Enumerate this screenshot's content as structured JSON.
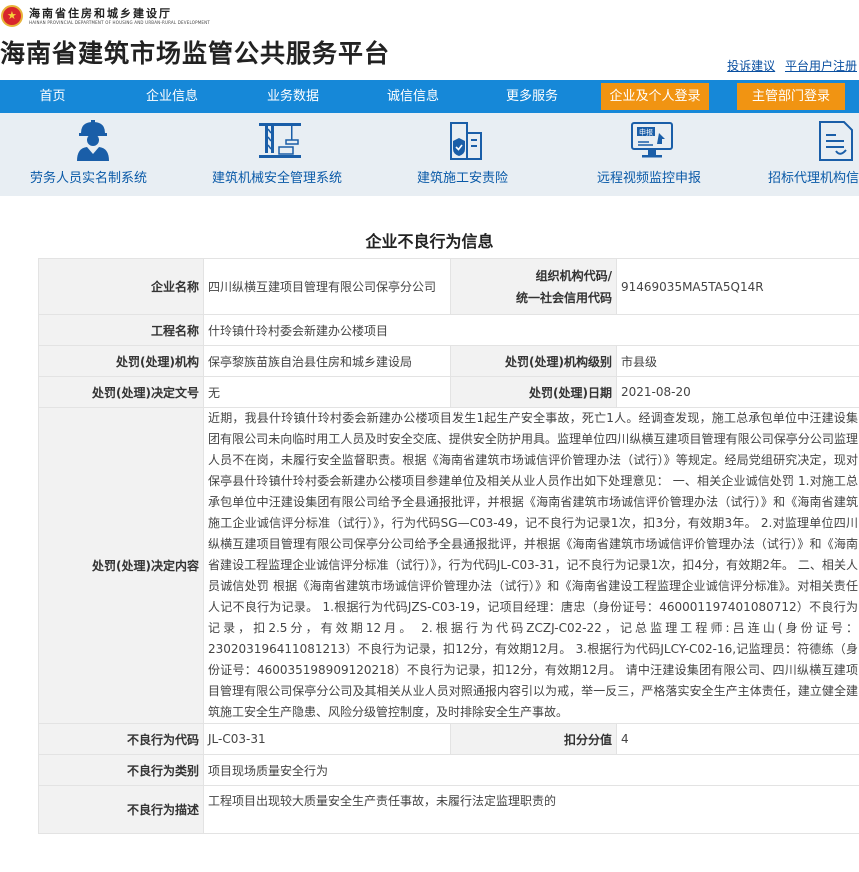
{
  "header": {
    "department_cn": "海南省住房和城乡建设厅",
    "department_en": "HAINAN PROVINCIAL DEPARTMENT OF HOUSING AND URBAN-RURAL DEVELOPMENT",
    "site_title": "海南省建筑市场监管公共服务平台",
    "links": [
      "投诉建议",
      "平台用户注册"
    ]
  },
  "nav": {
    "items": [
      "首页",
      "企业信息",
      "业务数据",
      "诚信信息",
      "更多服务"
    ],
    "buttons": [
      "企业及个人登录",
      "主管部门登录"
    ],
    "bar_color": "#1688d8",
    "button_color": "#f19412"
  },
  "systems": [
    {
      "label": "劳务人员实名制系统",
      "icon": "worker-icon"
    },
    {
      "label": "建筑机械安全管理系统",
      "icon": "crane-icon"
    },
    {
      "label": "建筑施工安责险",
      "icon": "insurance-building-icon"
    },
    {
      "label": "远程视频监控申报",
      "icon": "monitor-declare-icon"
    },
    {
      "label": "招标代理机构信",
      "icon": "document-icon"
    }
  ],
  "page_heading": "企业不良行为信息",
  "record": {
    "company_label": "企业名称",
    "company": "四川纵横互建项目管理有限公司保亭分公司",
    "org_code_label_1": "组织机构代码/",
    "org_code_label_2": "统一社会信用代码",
    "org_code": "91469035MA5TA5Q14R",
    "project_label": "工程名称",
    "project": "什玲镇什玲村委会新建办公楼项目",
    "authority_label": "处罚(处理)机构",
    "authority": "保亭黎族苗族自治县住房和城乡建设局",
    "authority_level_label": "处罚(处理)机构级别",
    "authority_level": "市县级",
    "decision_no_label": "处罚(处理)决定文号",
    "decision_no": "无",
    "decision_date_label": "处罚(处理)日期",
    "decision_date": "2021-08-20",
    "decision_content_label": "处罚(处理)决定内容",
    "decision_content": "近期，我县什玲镇什玲村委会新建办公楼项目发生1起生产安全事故，死亡1人。经调查发现，施工总承包单位中汪建设集团有限公司未向临时用工人员及时安全交底、提供安全防护用具。监理单位四川纵横互建项目管理有限公司保亭分公司监理人员不在岗，未履行安全监督职责。根据《海南省建筑市场诚信评价管理办法（试行）》等规定。经局党组研究决定，现对保亭县什玲镇什玲村委会新建办公楼项目参建单位及相关从业人员作出如下处理意见： 一、相关企业诚信处罚 1.对施工总承包单位中汪建设集团有限公司给予全县通报批评，并根据《海南省建筑市场诚信评价管理办法（试行）》和《海南省建筑施工企业诚信评分标准（试行）》，行为代码SG—C03-49，记不良行为记录1次，扣3分，有效期3年。 2.对监理单位四川纵横互建项目管理有限公司保亭分公司给予全县通报批评，并根据《海南省建筑市场诚信评价管理办法（试行）》和《海南省建设工程监理企业诚信评分标准（试行）》，行为代码JL-C03-31，记不良行为记录1次，扣4分，有效期2年。 二、相关人员诚信处罚 根据《海南省建筑市场诚信评价管理办法（试行）》和《海南省建设工程监理企业诚信评分标准》。对相关责任人记不良行为记录。 1.根据行为代码JZS-C03-19，记项目经理：唐忠（身份证号：460001197401080712）不良行为记录，扣2.5分，有效期12月。 2.根据行为代码ZCZJ-C02-22，记总监理工程师:吕连山(身份证号：230203196411081213）不良行为记录，扣12分，有效期12月。 3.根据行为代码JLCY-C02-16,记监理员：符德练（身份证号：460035198909120218）不良行为记录，扣12分，有效期12月。 请中汪建设集团有限公司、四川纵横互建项目管理有限公司保亭分公司及其相关从业人员对照通报内容引以为戒，举一反三，严格落实安全生产主体责任，建立健全建筑施工安全生产隐患、风险分级管控制度，及时排除安全生产事故。",
    "bad_code_label": "不良行为代码",
    "bad_code": "JL-C03-31",
    "deduct_label": "扣分分值",
    "deduct": "4",
    "bad_category_label": "不良行为类别",
    "bad_category": "项目现场质量安全行为",
    "bad_desc_label": "不良行为描述",
    "bad_desc": "工程项目出现较大质量安全生产责任事故，未履行法定监理职责的"
  }
}
